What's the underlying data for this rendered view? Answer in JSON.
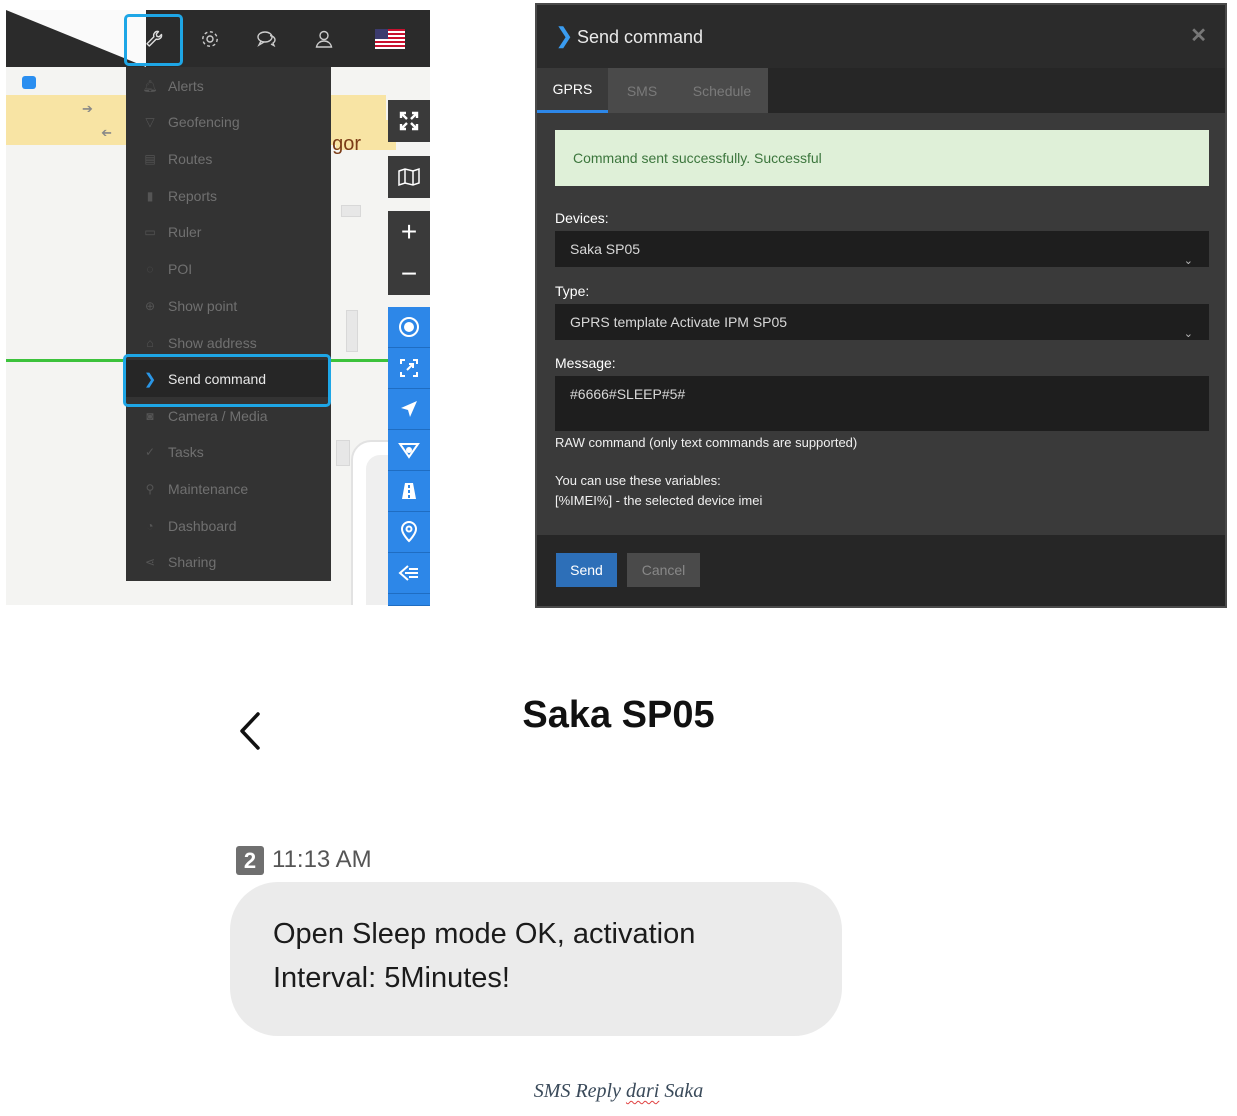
{
  "map_panel": {
    "map_label_fragment": "ngor",
    "menu": {
      "items": [
        {
          "label": "Alerts",
          "icon": "bell-icon"
        },
        {
          "label": "Geofencing",
          "icon": "geofence-icon"
        },
        {
          "label": "Routes",
          "icon": "road-icon"
        },
        {
          "label": "Reports",
          "icon": "bar-chart-icon"
        },
        {
          "label": "Ruler",
          "icon": "ruler-icon"
        },
        {
          "label": "POI",
          "icon": "map-pin-icon"
        },
        {
          "label": "Show point",
          "icon": "crosshair-icon"
        },
        {
          "label": "Show address",
          "icon": "house-icon"
        },
        {
          "label": "Send command",
          "icon": "chevron-right-icon",
          "active": true
        },
        {
          "label": "Camera / Media",
          "icon": "camera-icon"
        },
        {
          "label": "Tasks",
          "icon": "check-icon"
        },
        {
          "label": "Maintenance",
          "icon": "wrench-icon"
        },
        {
          "label": "Dashboard",
          "icon": "dashboard-icon"
        },
        {
          "label": "Sharing",
          "icon": "share-icon"
        }
      ]
    }
  },
  "send_command": {
    "title": "Send command",
    "tabs": [
      "GPRS",
      "SMS",
      "Schedule"
    ],
    "active_tab": "GPRS",
    "alert": "Command sent successfully. Successful",
    "devices_label": "Devices:",
    "devices_value": "Saka SP05",
    "type_label": "Type:",
    "type_value": "GPRS template Activate IPM SP05",
    "message_label": "Message:",
    "message_value": "#6666#SLEEP#5#",
    "raw_note": "RAW command (only text commands are supported)",
    "vars_title": "You can use these variables:",
    "vars_imei": "[%IMEI%] - the selected device imei",
    "send_label": "Send",
    "cancel_label": "Cancel"
  },
  "sms": {
    "contact": "Saka SP05",
    "sim_slot": "2",
    "time": "11:13 AM",
    "message_line1": "Open Sleep mode OK, activation",
    "message_line2": "Interval: 5Minutes!"
  },
  "caption": {
    "word1": "SMS Reply ",
    "word2": "dari",
    "word3": " Saka"
  },
  "colors": {
    "highlight": "#1ea6e6",
    "accent_blue": "#2d87e8",
    "success_bg": "#dff0d8",
    "success_text": "#3c763d",
    "send_button": "#2d6fb8"
  }
}
